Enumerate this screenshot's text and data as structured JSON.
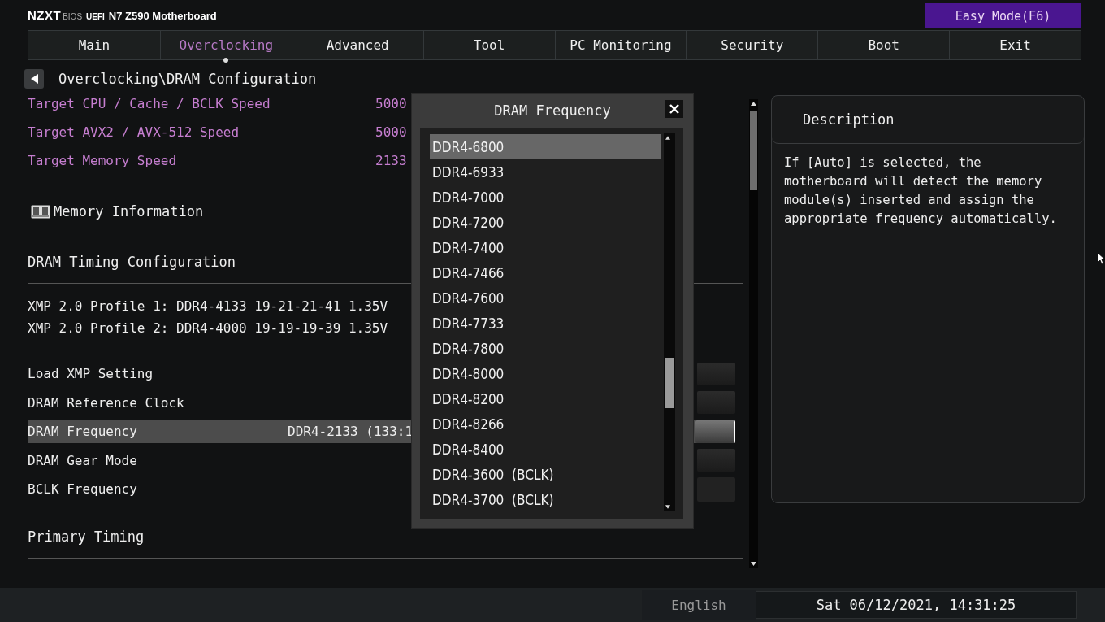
{
  "header": {
    "brand": "NZXT",
    "bios": "BIOS",
    "uefi": "UEFI",
    "board": "N7 Z590 Motherboard",
    "easy_mode": "Easy Mode(F6)"
  },
  "tabs": [
    {
      "label": "Main",
      "selected": false
    },
    {
      "label": "Overclocking",
      "selected": true
    },
    {
      "label": "Advanced",
      "selected": false
    },
    {
      "label": "Tool",
      "selected": false
    },
    {
      "label": "PC Monitoring",
      "selected": false
    },
    {
      "label": "Security",
      "selected": false
    },
    {
      "label": "Boot",
      "selected": false
    },
    {
      "label": "Exit",
      "selected": false
    }
  ],
  "breadcrumb": "Overclocking\\DRAM Configuration",
  "targets": [
    {
      "label": "Target CPU / Cache / BCLK Speed",
      "value": "5000"
    },
    {
      "label": "Target AVX2 / AVX-512 Speed",
      "value": "5000"
    },
    {
      "label": "Target Memory Speed",
      "value": "2133"
    }
  ],
  "memory_information": "Memory Information",
  "timing_heading": "DRAM Timing Configuration",
  "xmp_profiles": [
    "XMP 2.0 Profile 1: DDR4-4133 19-21-21-41 1.35V",
    "XMP 2.0 Profile 2: DDR4-4000 19-19-19-39 1.35V"
  ],
  "settings": [
    {
      "label": "Load XMP Setting",
      "kind": "select",
      "selected": false
    },
    {
      "label": "DRAM Reference Clock",
      "kind": "select",
      "selected": false
    },
    {
      "label": "DRAM Frequency",
      "value": "DDR4-2133 (133:1",
      "kind": "select",
      "selected": true
    },
    {
      "label": "DRAM Gear Mode",
      "kind": "select",
      "selected": false
    },
    {
      "label": "BCLK Frequency",
      "kind": "field",
      "selected": false
    }
  ],
  "primary_timing": "Primary Timing",
  "dialog": {
    "title": "DRAM Frequency",
    "options": [
      {
        "label": "DDR4-6800",
        "selected": true
      },
      {
        "label": "DDR4-6933",
        "selected": false
      },
      {
        "label": "DDR4-7000",
        "selected": false
      },
      {
        "label": "DDR4-7200",
        "selected": false
      },
      {
        "label": "DDR4-7400",
        "selected": false
      },
      {
        "label": "DDR4-7466",
        "selected": false
      },
      {
        "label": "DDR4-7600",
        "selected": false
      },
      {
        "label": "DDR4-7733",
        "selected": false
      },
      {
        "label": "DDR4-7800",
        "selected": false
      },
      {
        "label": "DDR4-8000",
        "selected": false
      },
      {
        "label": "DDR4-8200",
        "selected": false
      },
      {
        "label": "DDR4-8266",
        "selected": false
      },
      {
        "label": "DDR4-8400",
        "selected": false
      },
      {
        "label": "DDR4-3600  (BCLK)",
        "selected": false
      },
      {
        "label": "DDR4-3700  (BCLK)",
        "selected": false
      }
    ]
  },
  "description": {
    "title": "Description",
    "text": "If [Auto] is selected, the motherboard will detect the memory module(s) inserted and assign the appropriate frequency automatically."
  },
  "status_bar": {
    "language": "English",
    "datetime": "Sat 06/12/2021, 14:31:25"
  }
}
